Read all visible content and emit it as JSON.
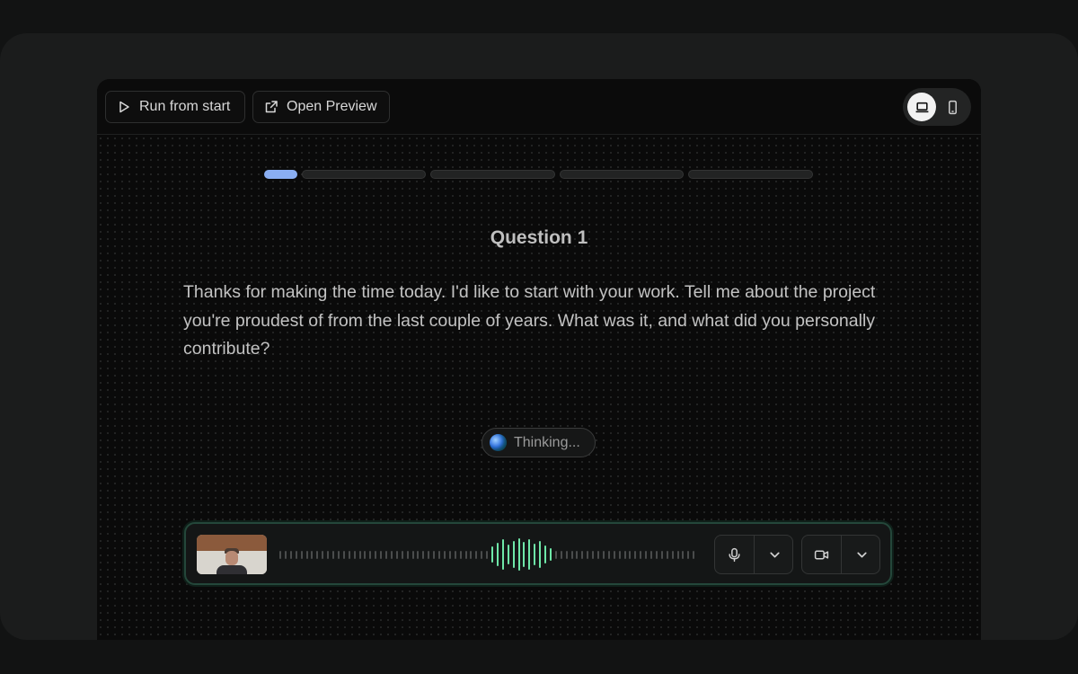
{
  "toolbar": {
    "run_label": "Run from start",
    "preview_label": "Open Preview",
    "view_mode": "laptop"
  },
  "progress": {
    "total_steps": 5,
    "current_step": 1,
    "active_color": "#8aaef2"
  },
  "question": {
    "title": "Question 1",
    "text": "Thanks for making the time today. I'd like to start with your work. Tell me about the project you're proudest of from the last couple of years. What was it, and what did you personally contribute?"
  },
  "status": {
    "label": "Thinking..."
  },
  "colors": {
    "wave_active": "#6ee7a8",
    "wave_idle": "#4a4c4c",
    "dock_border": "#24473a"
  },
  "icons": {
    "run": "play-icon",
    "preview": "external-link-icon",
    "laptop": "laptop-icon",
    "phone": "phone-icon",
    "mic": "microphone-icon",
    "camera": "video-camera-icon",
    "chevron": "chevron-down-icon"
  }
}
